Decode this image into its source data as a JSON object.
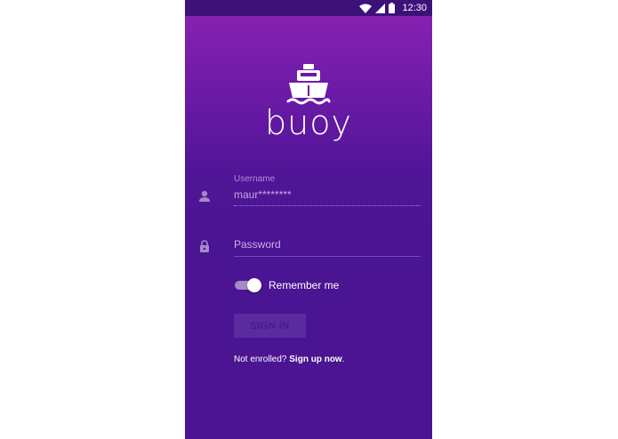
{
  "status_bar": {
    "time": "12:30",
    "icons": [
      "wifi-icon",
      "cell-signal-icon",
      "battery-icon"
    ]
  },
  "app": {
    "name": "buoy",
    "logo_icon": "ship-icon"
  },
  "username": {
    "label": "Username",
    "value": "maur********",
    "icon": "person-icon"
  },
  "password": {
    "placeholder": "Password",
    "icon": "lock-icon"
  },
  "remember": {
    "label": "Remember me",
    "enabled": true
  },
  "signin": {
    "label": "SIGN IN"
  },
  "enroll": {
    "prefix": "Not enrolled? ",
    "link": "Sign up now",
    "suffix": "."
  },
  "colors": {
    "gradient_top": "#8d22b3",
    "gradient_bottom": "#4a1492",
    "status_bar": "#3c1279"
  }
}
